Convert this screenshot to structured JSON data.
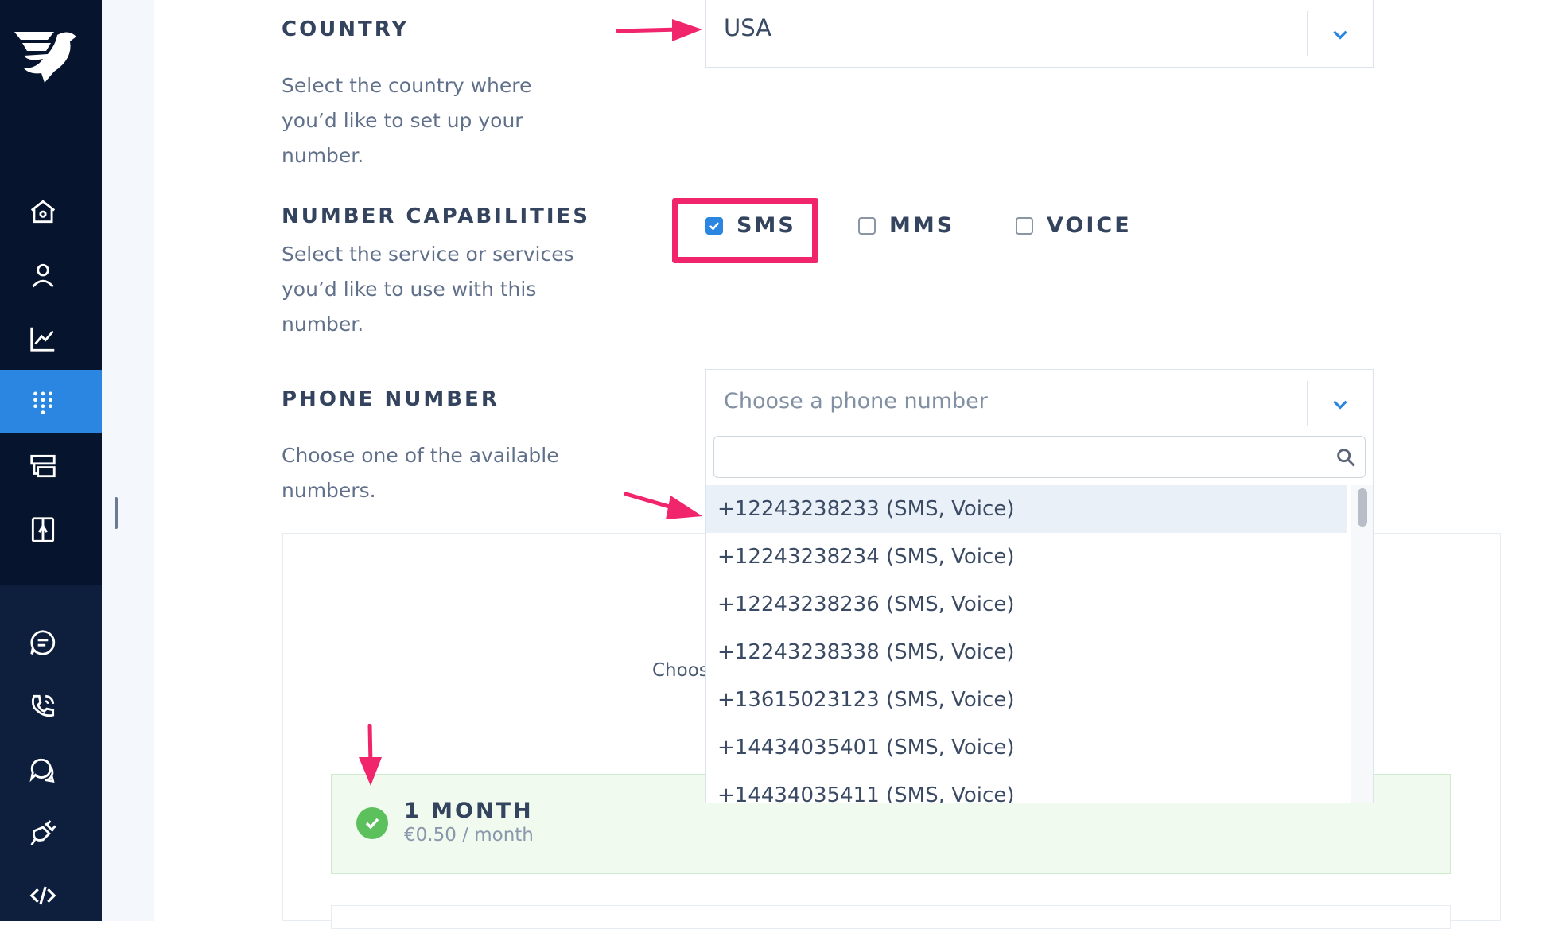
{
  "colors": {
    "accent": "#2a86e0",
    "highlight": "#f0256c",
    "sidebar": "#0d1f3d",
    "success": "#5cc05d"
  },
  "sidebar": {
    "logo": "messagebird-logo",
    "items": [
      {
        "icon": "home-icon"
      },
      {
        "icon": "contacts-icon"
      },
      {
        "icon": "analytics-icon"
      },
      {
        "icon": "numbers-grid-icon",
        "active": true
      },
      {
        "icon": "inbox-icon"
      },
      {
        "icon": "flow-icon"
      },
      {
        "icon": "chat-icon"
      },
      {
        "icon": "voice-icon"
      },
      {
        "icon": "conversations-icon"
      },
      {
        "icon": "connectors-icon"
      },
      {
        "icon": "developers-icon"
      }
    ]
  },
  "country": {
    "title": "COUNTRY",
    "description": "Select the country where you’d like to set up your number.",
    "selected": "USA"
  },
  "capabilities": {
    "title": "NUMBER CAPABILITIES",
    "description": "Select the service or services you’d like to use with this number.",
    "options": [
      {
        "label": "SMS",
        "checked": true
      },
      {
        "label": "MMS",
        "checked": false
      },
      {
        "label": "VOICE",
        "checked": false
      }
    ]
  },
  "phone_number": {
    "title": "PHONE NUMBER",
    "description": "Choose one of the available numbers.",
    "placeholder": "Choose a phone number",
    "search_value": "",
    "options": [
      "+12243238233 (SMS, Voice)",
      "+12243238234 (SMS, Voice)",
      "+12243238236 (SMS, Voice)",
      "+12243238338 (SMS, Voice)",
      "+13615023123 (SMS, Voice)",
      "+14434035401 (SMS, Voice)",
      "+14434035411 (SMS, Voice)"
    ]
  },
  "plan": {
    "partial_text": "Choos",
    "title": "1 MONTH",
    "price": "€0.50 / month",
    "selected": true
  }
}
